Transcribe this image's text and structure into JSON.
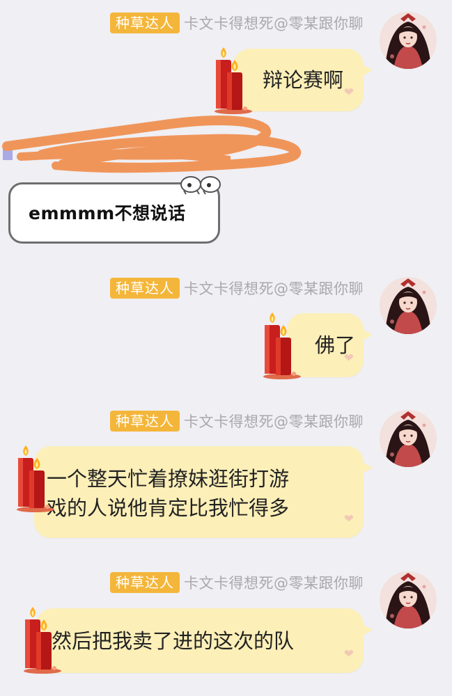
{
  "messages": [
    {
      "badge": "种草达人",
      "nickname": "卡文卡得想死@零某跟你聊",
      "text": "辩论赛啊"
    },
    {
      "badge": "种草达人",
      "nickname": "卡文卡得想死@零某跟你聊",
      "text": "佛了"
    },
    {
      "badge": "种草达人",
      "nickname": "卡文卡得想死@零某跟你聊",
      "lines": [
        "一个整天忙着撩妹逛街打游",
        "戏的人说他肯定比我忙得多"
      ]
    },
    {
      "badge": "种草达人",
      "nickname": "卡文卡得想死@零某跟你聊",
      "text": "然后把我卖了进的这次的队"
    }
  ],
  "incoming": {
    "text": "emmmm不想说话"
  },
  "colors": {
    "badge": "#f4b63a",
    "bubble": "#fcefb8",
    "background": "#efeff4",
    "scribble": "#f0955a"
  },
  "icons": {
    "candle": "candle-sticker-icon",
    "heart": "heart-icon",
    "avatar": "avatar-image"
  }
}
